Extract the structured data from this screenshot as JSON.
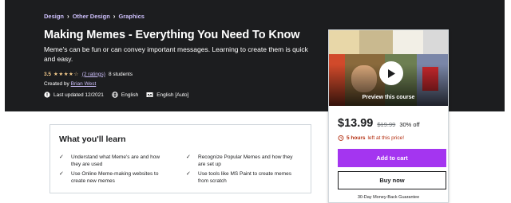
{
  "breadcrumb": [
    "Design",
    "Other Design",
    "Graphics"
  ],
  "course": {
    "title": "Making Memes - Everything You Need To Know",
    "subtitle": "Meme's can be fun or can convey important messages. Learning to create them is quick and easy.",
    "rating": "3.5",
    "rating_value": 3.5,
    "rating_max": 5,
    "stars_text": "★★★★☆",
    "ratings_link": "(2 ratings)",
    "students": "8 students",
    "creator_prefix": "Created by",
    "creator_name": "Brian West",
    "last_updated": "Last updated 12/2021",
    "language": "English",
    "captions": "English [Auto]"
  },
  "sidebar": {
    "preview_label": "Preview this course",
    "price": "$13.99",
    "original_price": "$19.99",
    "discount": "30% off",
    "timer_bold": "5 hours",
    "timer_rest": "left at this price!",
    "add_to_cart": "Add to cart",
    "buy_now": "Buy now",
    "guarantee": "30-Day Money-Back Guarantee"
  },
  "learn": {
    "title": "What you'll learn",
    "items": [
      "Understand what Meme's are and how they are used",
      "Recognize Popular Memes and how they are set up",
      "Use Online Meme-making websites to create new memes",
      "Use tools like MS Paint to create memes from scratch"
    ]
  },
  "colors": {
    "hero_bg": "#1c1d1f",
    "accent_purple": "#a435f0",
    "link_lavender": "#cec0fc",
    "star_gold": "#f3ca8c",
    "timer_red": "#b32d0f"
  },
  "icons": {
    "updated": "alert-circle-icon",
    "language": "globe-icon",
    "captions": "closed-captions-icon",
    "timer": "alarm-clock-icon",
    "play": "play-icon",
    "learn_bullet": "check-icon"
  }
}
